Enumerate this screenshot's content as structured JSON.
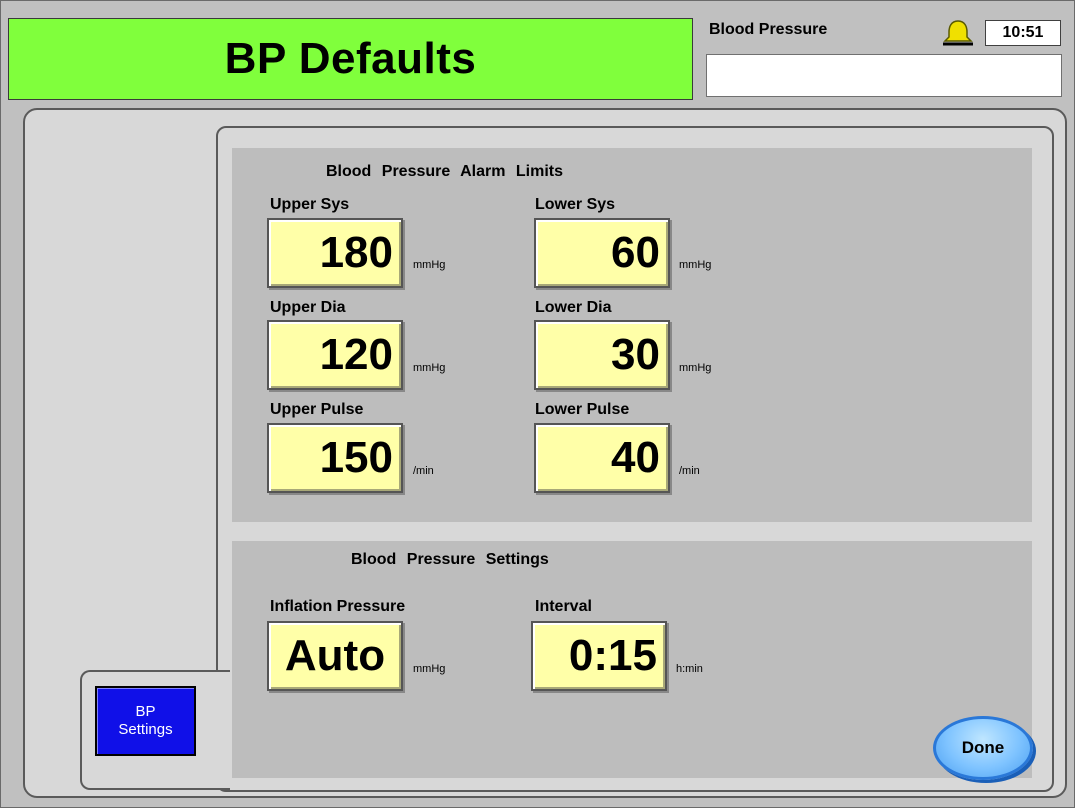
{
  "header": {
    "title": "BP Defaults",
    "mode_label": "Blood Pressure",
    "mode_value": "",
    "clock": "10:51",
    "alarm_icon_color": "#f0e000"
  },
  "alarm_limits": {
    "title": "Blood Pressure Alarm Limits",
    "upper_sys": {
      "label": "Upper Sys",
      "value": "180",
      "unit": "mmHg"
    },
    "lower_sys": {
      "label": "Lower Sys",
      "value": "60",
      "unit": "mmHg"
    },
    "upper_dia": {
      "label": "Upper Dia",
      "value": "120",
      "unit": "mmHg"
    },
    "lower_dia": {
      "label": "Lower Dia",
      "value": "30",
      "unit": "mmHg"
    },
    "upper_pulse": {
      "label": "Upper Pulse",
      "value": "150",
      "unit": "/min"
    },
    "lower_pulse": {
      "label": "Lower Pulse",
      "value": "40",
      "unit": "/min"
    }
  },
  "settings": {
    "title": "Blood Pressure Settings",
    "inflation": {
      "label": "Inflation Pressure",
      "value": "Auto",
      "unit": "mmHg"
    },
    "interval": {
      "label": "Interval",
      "value": "0:15",
      "unit": "h:min"
    }
  },
  "tabs": {
    "bp_settings_line1": "BP",
    "bp_settings_line2": "Settings"
  },
  "buttons": {
    "done": "Done"
  },
  "colors": {
    "title_bg": "#80ff3c",
    "value_bg": "#ffffa8",
    "tab_bg": "#1010e8",
    "done_bg": "#7ec3ff"
  }
}
